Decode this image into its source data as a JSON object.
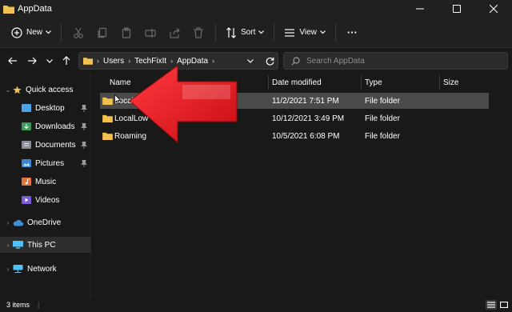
{
  "window": {
    "title": "AppData"
  },
  "toolbar": {
    "new_label": "New",
    "sort_label": "Sort",
    "view_label": "View",
    "more_label": "···"
  },
  "address": {
    "crumbs": [
      "Users",
      "TechFixIt",
      "AppData"
    ]
  },
  "search": {
    "placeholder": "Search AppData"
  },
  "sidebar": {
    "quick_access": "Quick access",
    "items": [
      {
        "label": "Desktop",
        "icon": "desktop-icon",
        "pinned": true
      },
      {
        "label": "Downloads",
        "icon": "downloads-icon",
        "pinned": true
      },
      {
        "label": "Documents",
        "icon": "documents-icon",
        "pinned": true
      },
      {
        "label": "Pictures",
        "icon": "pictures-icon",
        "pinned": true
      },
      {
        "label": "Music",
        "icon": "music-icon",
        "pinned": false
      },
      {
        "label": "Videos",
        "icon": "videos-icon",
        "pinned": false
      }
    ],
    "onedrive": "OneDrive",
    "this_pc": "This PC",
    "network": "Network"
  },
  "columns": {
    "name": "Name",
    "date": "Date modified",
    "type": "Type",
    "size": "Size"
  },
  "files": [
    {
      "name": "Local",
      "date": "11/2/2021 7:51 PM",
      "type": "File folder",
      "size": ""
    },
    {
      "name": "LocalLow",
      "date": "10/12/2021 3:49 PM",
      "type": "File folder",
      "size": ""
    },
    {
      "name": "Roaming",
      "date": "10/5/2021 6:08 PM",
      "type": "File folder",
      "size": ""
    }
  ],
  "status": {
    "count": "3 items"
  },
  "colors": {
    "folder": "#f2c14e",
    "arrow": "#e0141a",
    "accent": "#4cc2ff"
  }
}
